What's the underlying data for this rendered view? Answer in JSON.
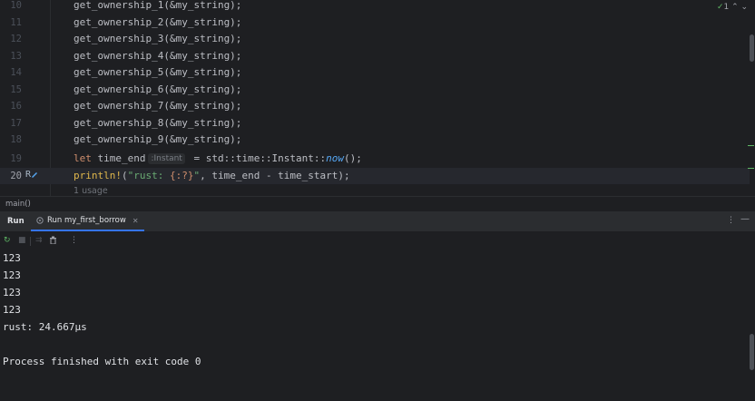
{
  "editor": {
    "lines": [
      {
        "num": "10",
        "code": "get_ownership_1(&my_string);"
      },
      {
        "num": "11",
        "code": "get_ownership_2(&my_string);"
      },
      {
        "num": "12",
        "code": "get_ownership_3(&my_string);"
      },
      {
        "num": "13",
        "code": "get_ownership_4(&my_string);"
      },
      {
        "num": "14",
        "code": "get_ownership_5(&my_string);"
      },
      {
        "num": "15",
        "code": "get_ownership_6(&my_string);"
      },
      {
        "num": "16",
        "code": "get_ownership_7(&my_string);"
      },
      {
        "num": "17",
        "code": "get_ownership_8(&my_string);"
      },
      {
        "num": "18",
        "code": "get_ownership_9(&my_string);"
      }
    ],
    "line19": {
      "num": "19",
      "kw": "let",
      "var": " time_end",
      "hint": ":Instant",
      "rhs": " = std::time::Instant::",
      "fn": "now",
      "tail": "();"
    },
    "line20": {
      "num": "20",
      "gutter_icon": "R",
      "macro": "println!",
      "open": "(",
      "str1": "\"rust: ",
      "fmt": "{:?}",
      "str2": "\"",
      "rest": ", time_end - time_start);"
    },
    "usages_hint": "1 usage",
    "inspection": {
      "check": "✓",
      "count": "1",
      "arrows": "⌃ ⌄"
    }
  },
  "breadcrumb": "main()",
  "run_panel": {
    "title": "Run",
    "tab_label": "Run my_first_borrow",
    "more_icon": "⋮",
    "minimize_icon": "—"
  },
  "toolbar": {
    "rerun": "↻",
    "stop": "■",
    "soft_wrap": "⇉",
    "clear": "🗑",
    "more": "⋮"
  },
  "console": {
    "lines": [
      "123",
      "123",
      "123",
      "123",
      "rust: 24.667µs",
      "",
      "Process finished with exit code 0"
    ]
  }
}
